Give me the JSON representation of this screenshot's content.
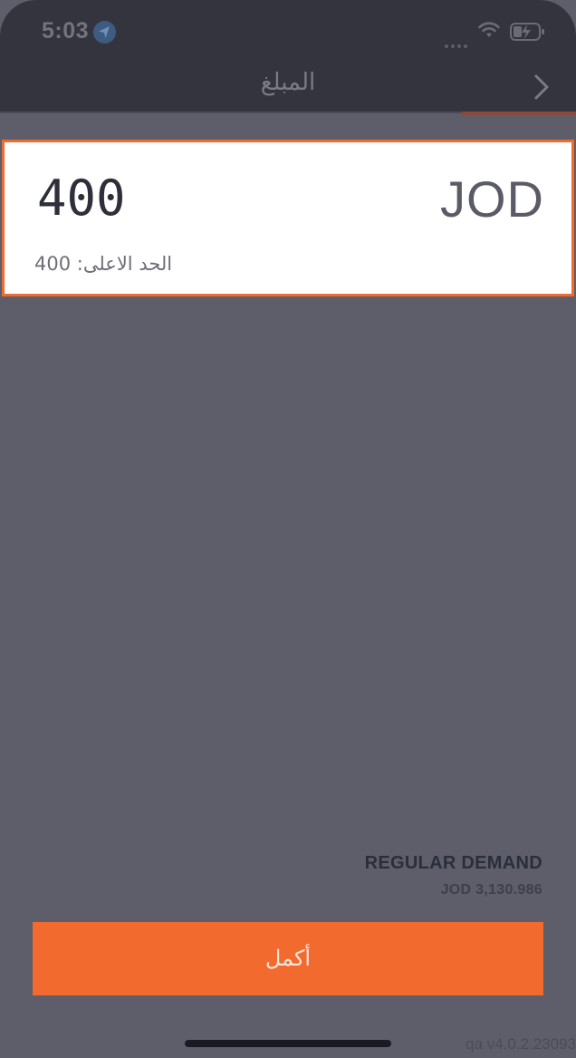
{
  "status_bar": {
    "time": "5:03",
    "icons": [
      "location-arrow-icon",
      "signal-dots-icon",
      "wifi-icon",
      "battery-charging-icon"
    ]
  },
  "nav": {
    "title": "المبلغ",
    "back_icon": "chevron-right-icon"
  },
  "amount_card": {
    "value": "400",
    "currency": "JOD",
    "max_limit": "الحد الاعلى: 400"
  },
  "demand": {
    "label": "REGULAR DEMAND",
    "amount": "JOD 3,130.986"
  },
  "continue_button": {
    "label": "أكمل"
  },
  "footer": {
    "version": "qa v4.0.2.23093"
  },
  "colors": {
    "accent": "#f26a2e",
    "background": "#5d5e6a",
    "bar": "#34343f",
    "card": "#ffffff"
  }
}
